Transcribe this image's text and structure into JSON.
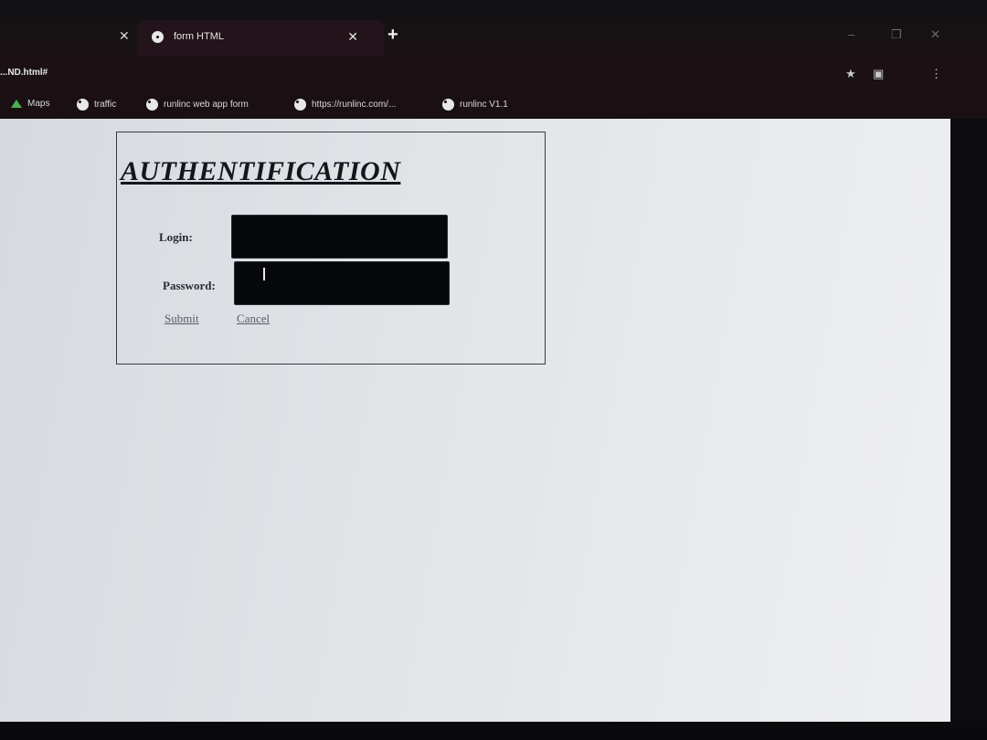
{
  "browser": {
    "active_tab_title": "form HTML",
    "address_url": "...ND.html#",
    "bookmarks": [
      {
        "label": "Maps"
      },
      {
        "label": "traffic"
      },
      {
        "label": "runlinc web app form"
      },
      {
        "label": "https://runlinc.com/..."
      },
      {
        "label": "runlinc V1.1"
      }
    ]
  },
  "form": {
    "title": "AUTHENTIFICATION",
    "login_label": "Login:",
    "login_value": "",
    "password_label": "Password:",
    "password_value": "",
    "submit_label": "Submit",
    "cancel_label": "Cancel"
  }
}
